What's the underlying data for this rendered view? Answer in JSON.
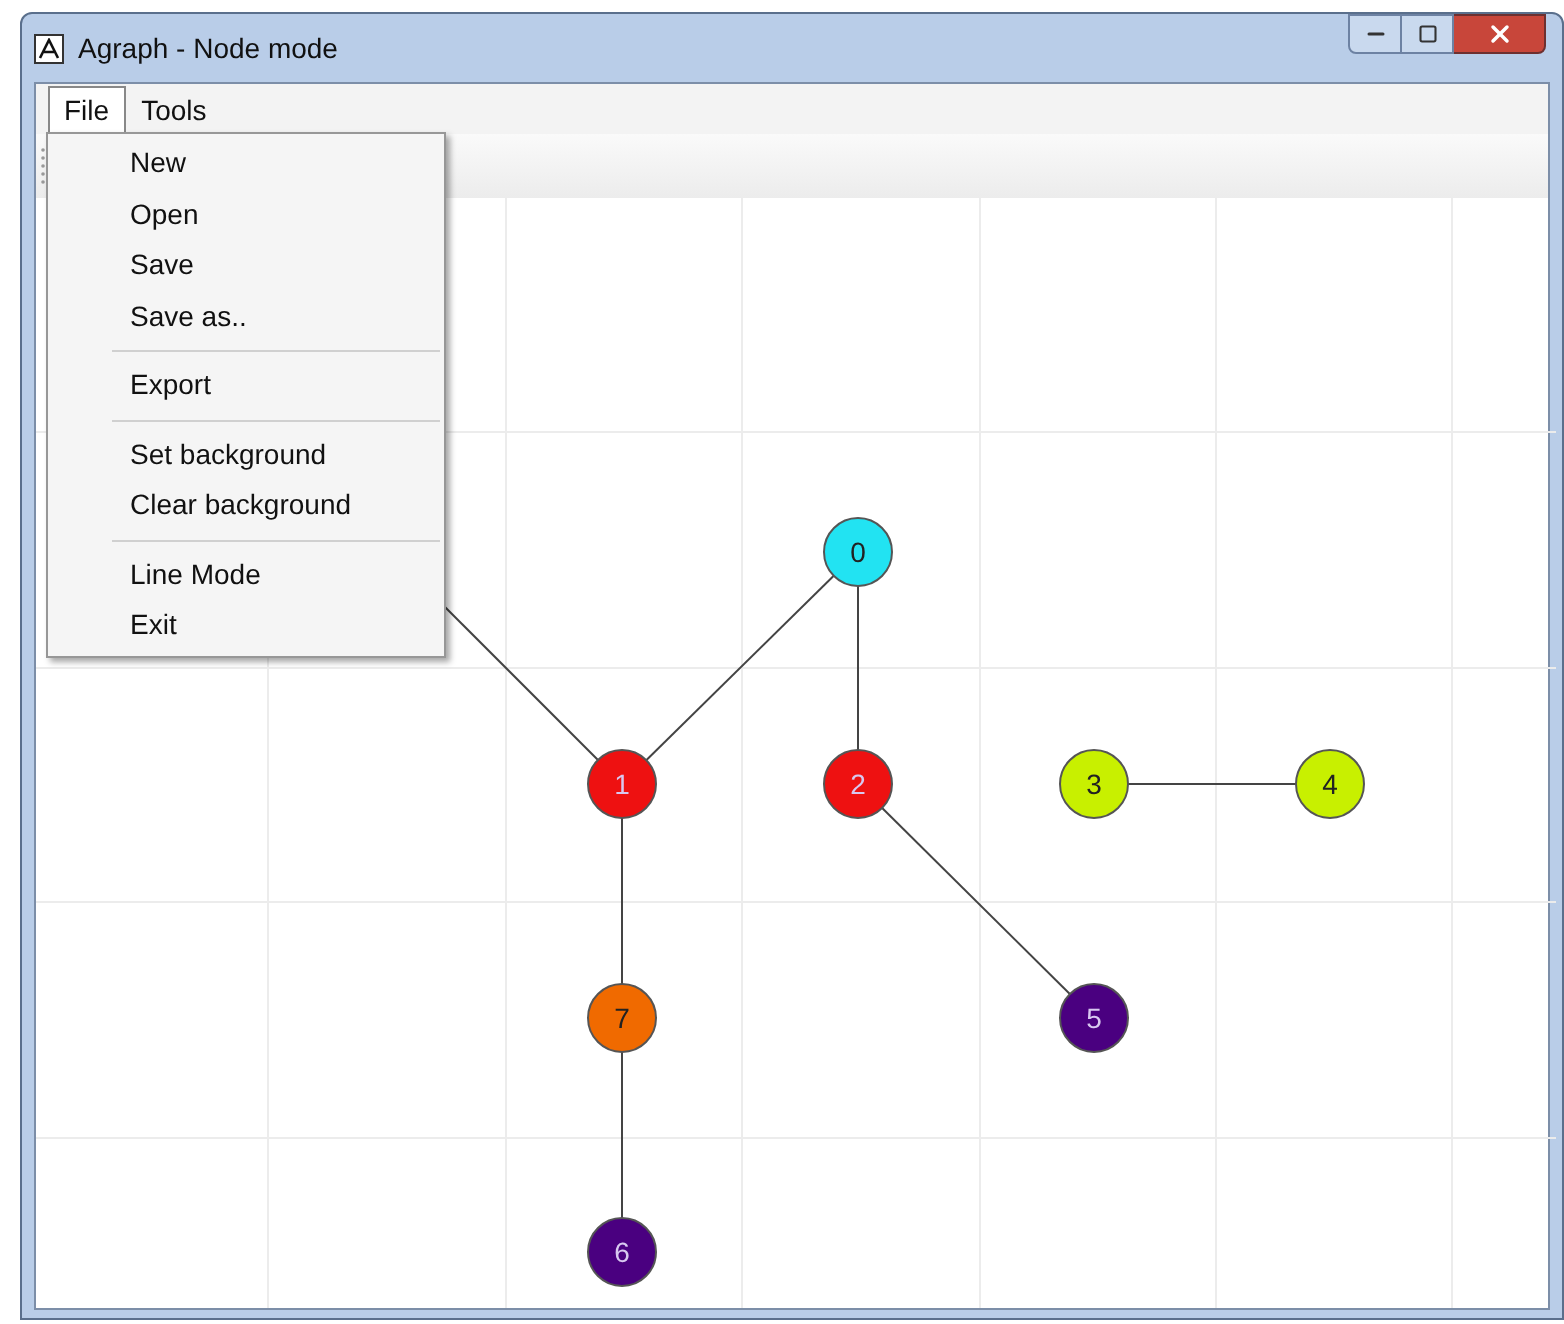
{
  "window": {
    "title": "Agraph - Node mode"
  },
  "menu_bar": [
    {
      "label": "File",
      "selected": true
    },
    {
      "label": "Tools",
      "selected": false
    }
  ],
  "file_menu": [
    [
      "New",
      "Open",
      "Save",
      "Save as.."
    ],
    [
      "Export"
    ],
    [
      "Set background",
      "Clear background"
    ],
    [
      "Line Mode",
      "Exit"
    ]
  ],
  "graph": {
    "nodes": [
      {
        "label": "0",
        "color": "#22e3f2"
      },
      {
        "label": "1",
        "color": "#ee1111"
      },
      {
        "label": "2",
        "color": "#ee1111"
      },
      {
        "label": "3",
        "color": "#c8f000"
      },
      {
        "label": "4",
        "color": "#c8f000"
      },
      {
        "label": "7",
        "color": "#f06a00"
      },
      {
        "label": "5",
        "color": "#4a0080"
      },
      {
        "label": "6",
        "color": "#4a0080"
      }
    ]
  }
}
